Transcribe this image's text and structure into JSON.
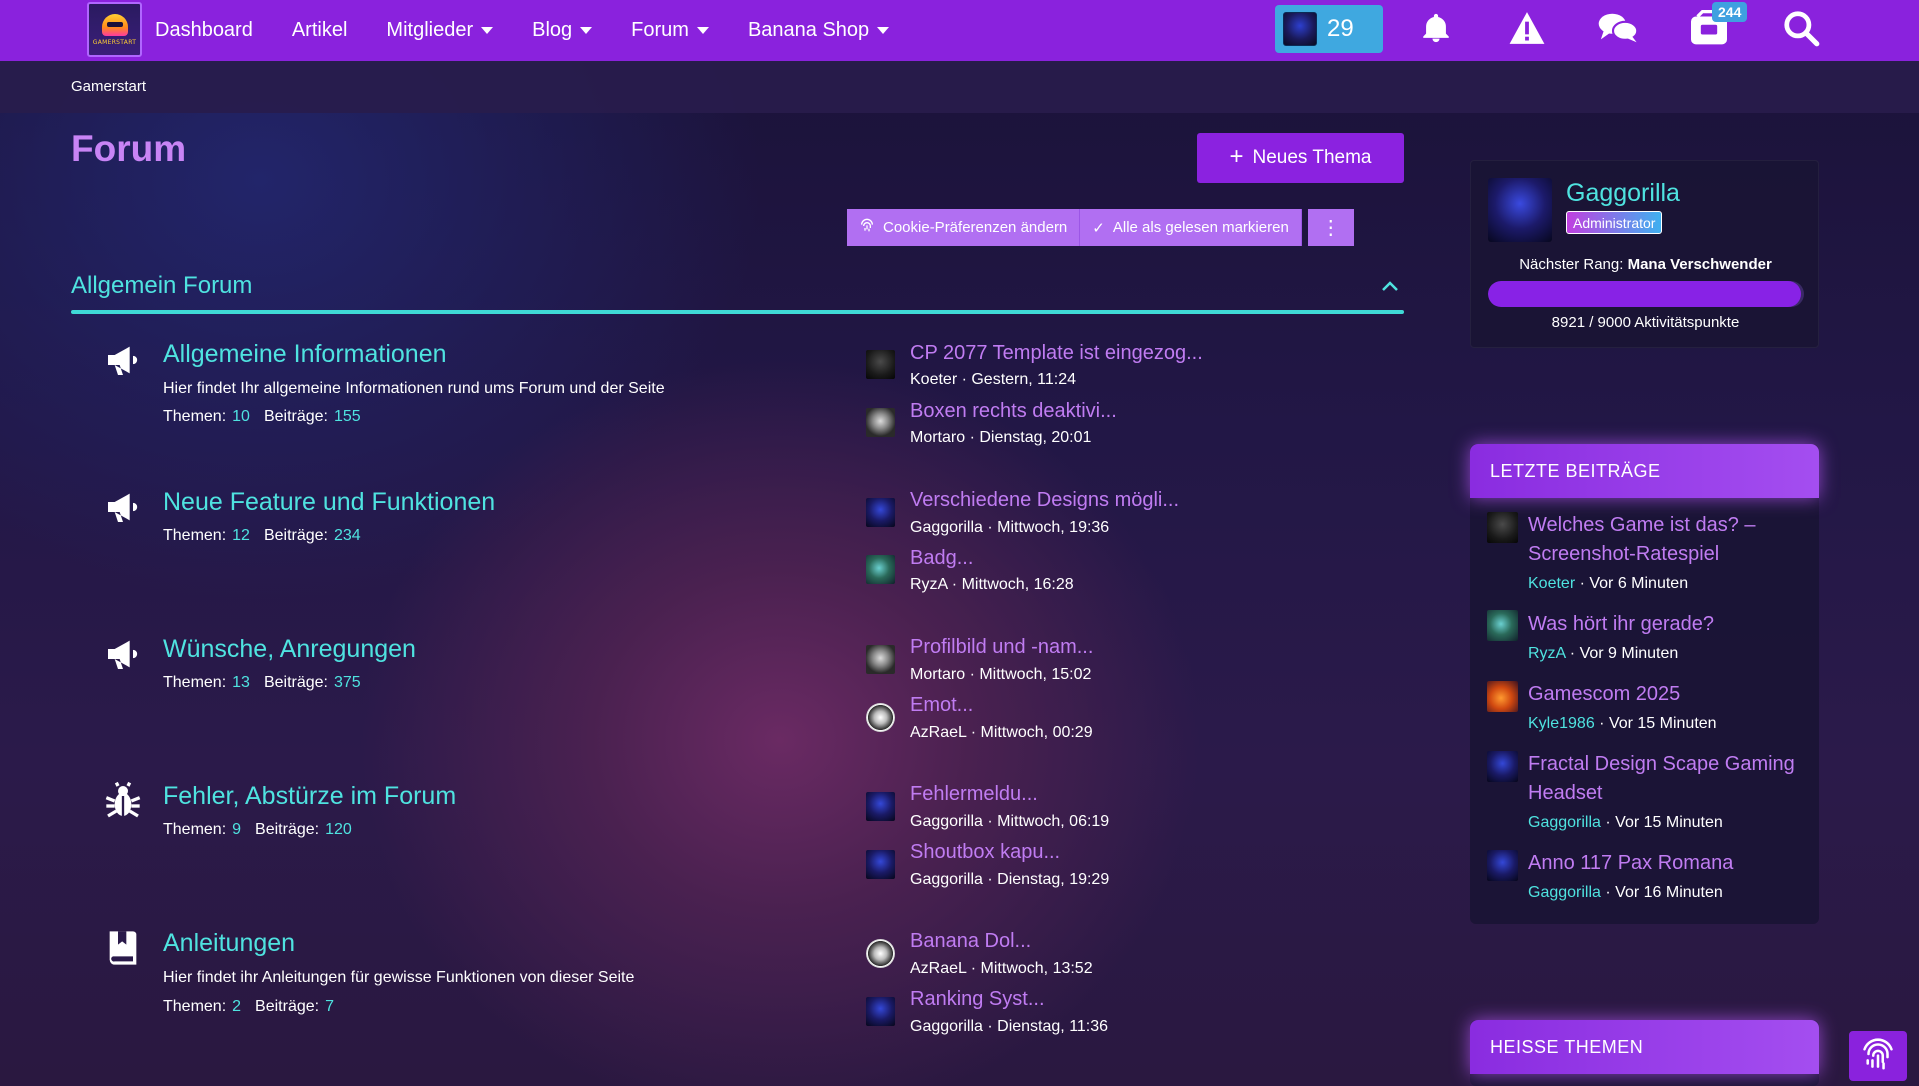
{
  "nav": {
    "logo_text": "GAMERSTART",
    "items": [
      {
        "label": "Dashboard",
        "dropdown": false
      },
      {
        "label": "Artikel",
        "dropdown": false
      },
      {
        "label": "Mitglieder",
        "dropdown": true
      },
      {
        "label": "Blog",
        "dropdown": true
      },
      {
        "label": "Forum",
        "dropdown": true
      },
      {
        "label": "Banana Shop",
        "dropdown": true
      }
    ],
    "points": "29",
    "messages_badge": "244",
    "icons": [
      "bell-icon",
      "warning-icon",
      "chat-icon",
      "inbox-icon",
      "search-icon"
    ]
  },
  "breadcrumb": "Gamerstart",
  "page": {
    "title": "Forum",
    "new_topic_label": "Neues Thema",
    "actions": {
      "cookie": "Cookie-Präferenzen ändern",
      "mark_read": "Alle als gelesen markieren",
      "more": "⋮"
    }
  },
  "section": {
    "title": "Allgemein Forum",
    "forums": [
      {
        "icon": "megaphone-icon",
        "name": "Allgemeine Informationen",
        "desc": "Hier findet Ihr allgemeine Informationen rund ums Forum und der Seite",
        "topics_label": "Themen:",
        "topics": "10",
        "posts_label": "Beiträge:",
        "posts": "155",
        "last": [
          {
            "title": "CP 2077 Template ist eingezog...",
            "meta": "Koeter · Gestern, 11:24",
            "avatar": "dark"
          },
          {
            "title": "Boxen rechts deaktivi...",
            "meta": "Mortaro · Dienstag, 20:01",
            "avatar": "skull"
          }
        ]
      },
      {
        "icon": "megaphone-icon",
        "name": "Neue Feature und Funktionen",
        "desc": "",
        "topics_label": "Themen:",
        "topics": "12",
        "posts_label": "Beiträge:",
        "posts": "234",
        "last": [
          {
            "title": "Verschiedene Designs mögli...",
            "meta": "Gaggorilla · Mittwoch, 19:36",
            "avatar": "blue"
          },
          {
            "title": "Badg...",
            "meta": "RyzA · Mittwoch, 16:28",
            "avatar": "green"
          }
        ]
      },
      {
        "icon": "megaphone-icon",
        "name": "Wünsche, Anregungen",
        "desc": "",
        "topics_label": "Themen:",
        "topics": "13",
        "posts_label": "Beiträge:",
        "posts": "375",
        "last": [
          {
            "title": "Profilbild und -nam...",
            "meta": "Mortaro · Mittwoch, 15:02",
            "avatar": "skull"
          },
          {
            "title": "Emot...",
            "meta": "AzRaeL · Mittwoch, 00:29",
            "avatar": "bio"
          }
        ]
      },
      {
        "icon": "bug-icon",
        "name": "Fehler, Abstürze im Forum",
        "desc": "",
        "topics_label": "Themen:",
        "topics": "9",
        "posts_label": "Beiträge:",
        "posts": "120",
        "last": [
          {
            "title": "Fehlermeldu...",
            "meta": "Gaggorilla · Mittwoch, 06:19",
            "avatar": "blue"
          },
          {
            "title": "Shoutbox kapu...",
            "meta": "Gaggorilla · Dienstag, 19:29",
            "avatar": "blue"
          }
        ]
      },
      {
        "icon": "book-icon",
        "name": "Anleitungen",
        "desc": "Hier findet ihr Anleitungen für gewisse Funktionen von dieser Seite",
        "topics_label": "Themen:",
        "topics": "2",
        "posts_label": "Beiträge:",
        "posts": "7",
        "last": [
          {
            "title": "Banana Dol...",
            "meta": "AzRaeL · Mittwoch, 13:52",
            "avatar": "bio"
          },
          {
            "title": "Ranking Syst...",
            "meta": "Gaggorilla · Dienstag, 11:36",
            "avatar": "blue"
          }
        ]
      }
    ]
  },
  "user": {
    "name": "Gaggorilla",
    "role": "Administrator",
    "next_rank_label": "Nächster Rang:",
    "next_rank": "Mana Verschwender",
    "progress": 0.9912,
    "points_text": "8921 / 9000 Aktivitätspunkte"
  },
  "latest": {
    "title": "LETZTE BEITRÄGE",
    "items": [
      {
        "title": "Welches Game ist das? – Screenshot-Ratespiel",
        "user": "Koeter",
        "time": "Vor 6 Minuten",
        "avatar": "dark"
      },
      {
        "title": "Was hört ihr gerade?",
        "user": "RyzA",
        "time": "Vor 9 Minuten",
        "avatar": "green"
      },
      {
        "title": "Gamescom 2025",
        "user": "Kyle1986",
        "time": "Vor 15 Minuten",
        "avatar": "orange"
      },
      {
        "title": "Fractal Design Scape Gaming Headset",
        "user": "Gaggorilla",
        "time": "Vor 15 Minuten",
        "avatar": "blue"
      },
      {
        "title": "Anno 117 Pax Romana",
        "user": "Gaggorilla",
        "time": "Vor 16 Minuten",
        "avatar": "blue"
      }
    ]
  },
  "hot": {
    "title": "HEISSE THEMEN"
  }
}
